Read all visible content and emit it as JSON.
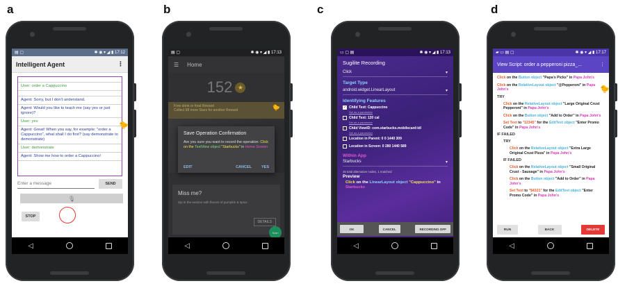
{
  "labels": {
    "a": "a",
    "b": "b",
    "c": "c",
    "d": "d"
  },
  "status_time": {
    "a": "17:12",
    "b": "17:13",
    "c": "17:13",
    "d": "17:17"
  },
  "panel_a": {
    "title": "Intelligent Agent",
    "menu": "⋮",
    "messages": [
      {
        "role": "user",
        "text": "User: order a Cappuccino"
      },
      {
        "role": "agent",
        "text": "Agent: Sorry, but I don't understand."
      },
      {
        "role": "agent",
        "text": "Agent: Would you like to teach me (say yes or just ignore)?"
      },
      {
        "role": "user",
        "text": "User: yes"
      },
      {
        "role": "agent",
        "text": "Agent: Great! When you say, for example: \"order a Cappuccino\", what shall I do first? (say demonstrate to demonstrate)"
      },
      {
        "role": "user",
        "text": "User: demonstrate"
      },
      {
        "role": "agent",
        "text": "Agent: Show me how to order a Cappuccino!"
      }
    ],
    "input_placeholder": "Enter a message",
    "send_label": "SEND",
    "stop_label": "STOP"
  },
  "panel_b": {
    "title": "Home",
    "score": "152",
    "reward_line1": "Free drink or food Reward",
    "reward_line2": "Collect 98 more Stars for another Reward",
    "dialog_title": "Save Operation Confirmation",
    "dialog_body_1": "Are you sure you want to record the operation: ",
    "dialog_click": "Click",
    "dialog_on": " on the ",
    "dialog_object": "TextView object",
    "dialog_quote": "\"Starbucks\"",
    "dialog_in": " in ",
    "dialog_screen": "Home Screen",
    "edit_label": "EDIT",
    "cancel_label": "CANCEL",
    "yes_label": "YES",
    "card_title": "Miss me?",
    "card_body": "Sip in the season with flavors of pumpkin & spice.",
    "details_label": "DETAILS",
    "fab_label": "Scan"
  },
  "panel_c": {
    "title": "Sugilite Recording",
    "action": "Click",
    "target_label": "Target Type",
    "target_value": "android.widget.LinearLayout",
    "features_label": "Identifying Features",
    "features": [
      {
        "checked": true,
        "text": "Child Text: Cappuccino"
      },
      {
        "checked": false,
        "text": "Child Text: 120 cal"
      },
      {
        "checked": false,
        "text": "Child ViewID: com.starbucks.mobilecard:id/"
      },
      {
        "checked": false,
        "text": "Location in Parent: 0 0 1440 309"
      },
      {
        "checked": false,
        "text": "Location in Screen: 0 280 1440 589"
      }
    ],
    "set_param": "Set as a parameter",
    "within_label": "Within App",
    "within_value": "Starbucks",
    "summary": "46 total alternative nodes, 1 matched",
    "preview_label": "Preview",
    "preview_click": "Click",
    "preview_on": " on the ",
    "preview_object": "LinearLayout object",
    "preview_quote": "\"Cappuccino\"",
    "preview_in": " in ",
    "preview_app": "Starbucks",
    "ok_label": "OK",
    "cancel_label": "CANCEL",
    "recording_off_label": "RECORDING OFF"
  },
  "panel_d": {
    "title": "View Script: order a pepperoni pizza_...",
    "lines": {
      "l1_obj": "Button object",
      "l1_val": "\"Papa's Picks\"",
      "l1_app": "Papa John's",
      "l2_obj": "RelativeLayout object",
      "l2_val": "\"@Pepperoni\"",
      "l2_app": "Papa John's",
      "try1": "TRY",
      "l3_obj": "RelativeLayout object",
      "l3_val": "\"Large Original Crust Pepperoni\"",
      "l3_app": "Papa John's",
      "l4_obj": "Button object",
      "l4_val": "\"Add to Order\"",
      "l4_app": "Papa John's",
      "l5_val": "\"12345\"",
      "l5_obj": "EditText object",
      "l5_field": "\"Enter Promo Code\"",
      "l5_app": "Papa John's",
      "if_failed1": "IF FAILED",
      "try2": "TRY",
      "l6_obj": "RelativeLayout object",
      "l6_val": "\"Extra Large Original Crust Pizza\"",
      "l6_app": "Papa John's",
      "if_failed2": "IF FAILED",
      "l7_obj": "RelativeLayout object",
      "l7_val": "\"Small Original Crust - Sausage\"",
      "l7_app": "Papa John's",
      "l8_obj": "Button object",
      "l8_val": "\"Add to Order\"",
      "l8_app": "Papa John's",
      "l9_val": "\"$4321\"",
      "l9_obj": "EditText object",
      "l9_field": "\"Enter Promo Code\"",
      "l9_app": "Papa John's"
    },
    "w_click": "Click",
    "w_on": " on the ",
    "w_in": " in ",
    "w_set": "Set Text",
    "w_to": " to ",
    "w_for": " for the ",
    "run_label": "RUN",
    "back_label": "BACK",
    "delete_label": "DELETE"
  }
}
